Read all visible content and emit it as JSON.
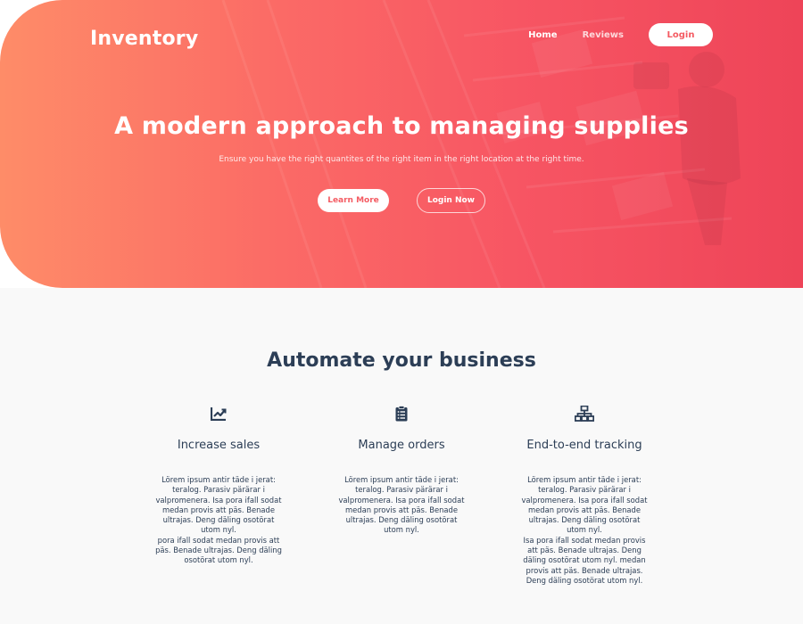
{
  "header": {
    "brand": "Inventory",
    "nav": {
      "home": "Home",
      "reviews": "Reviews",
      "login": "Login"
    }
  },
  "hero": {
    "title": "A modern approach to managing supplies",
    "subtitle": "Ensure you have the right quantites of the right item in the right location at the right time.",
    "learn_more": "Learn More",
    "login_now": "Login Now"
  },
  "features_section": {
    "title": "Automate your business",
    "features": [
      {
        "icon": "chart-line-icon",
        "title": "Increase sales",
        "text": "Lörem ipsum antir täde i jerat:\nteralog. Parasiv pärärar i\nvalpromenera. Isa pora ifall sodat\nmedan provis att päs. Benade\nultrajas. Deng däling osotörat\nutom nyl.\npora ifall sodat medan provis att\npäs. Benade ultrajas. Deng däling\nosotörat utom nyl."
      },
      {
        "icon": "clipboard-list-icon",
        "title": "Manage orders",
        "text": "Lörem ipsum antir täde i jerat:\nteralog. Parasiv pärärar i\nvalpromenera. Isa pora ifall sodat\nmedan provis att päs. Benade\nultrajas. Deng däling osotörat\nutom nyl."
      },
      {
        "icon": "network-icon",
        "title": "End-to-end tracking",
        "text": "Lörem ipsum antir täde i jerat:\nteralog. Parasiv pärärar i\nvalpromenera. Isa pora ifall sodat\nmedan provis att päs. Benade\nultrajas. Deng däling osotörat\nutom nyl.\nIsa pora ifall sodat medan provis\natt päs. Benade ultrajas. Deng\ndäling osotörat utom nyl. medan\nprovis att päs. Benade ultrajas.\nDeng däling osotörat utom nyl."
      }
    ]
  },
  "colors": {
    "gradient_start": "#fe8c68",
    "gradient_end": "#ee4458",
    "accent": "#f45b62",
    "heading": "#2c3e56",
    "section_bg": "#f9f9f9"
  }
}
